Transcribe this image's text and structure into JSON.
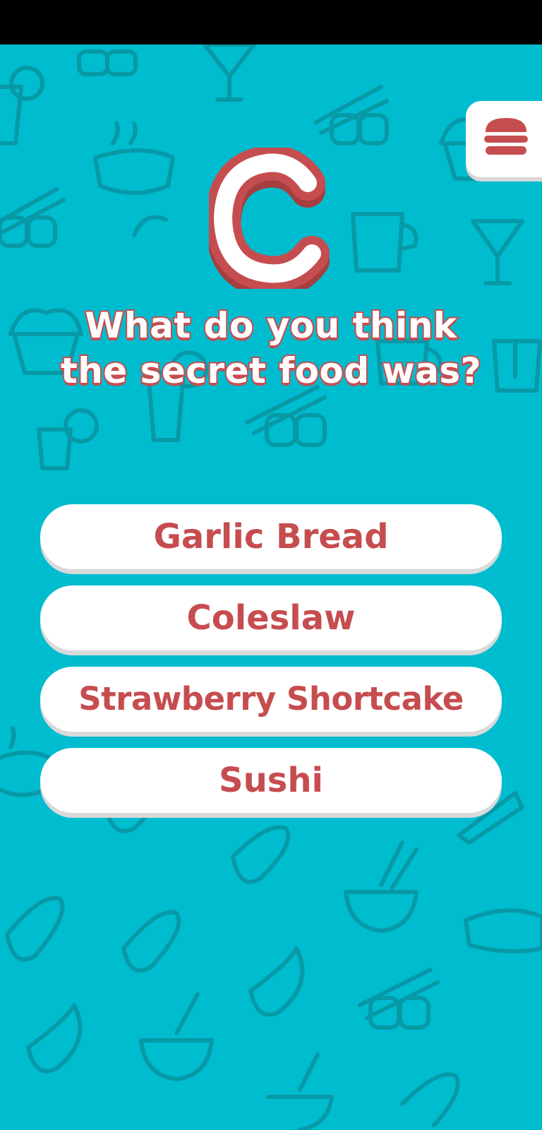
{
  "colors": {
    "background": "#00bccf",
    "doodle": "#0a8e99",
    "accent": "#c64d4f",
    "button": "#ffffff"
  },
  "menu": {
    "icon": "burger-icon"
  },
  "logo": {
    "letter": "C"
  },
  "question": {
    "text": "What do you think\nthe secret food was?"
  },
  "answers": [
    {
      "label": "Garlic Bread"
    },
    {
      "label": "Coleslaw"
    },
    {
      "label": "Strawberry Shortcake"
    },
    {
      "label": "Sushi"
    }
  ]
}
